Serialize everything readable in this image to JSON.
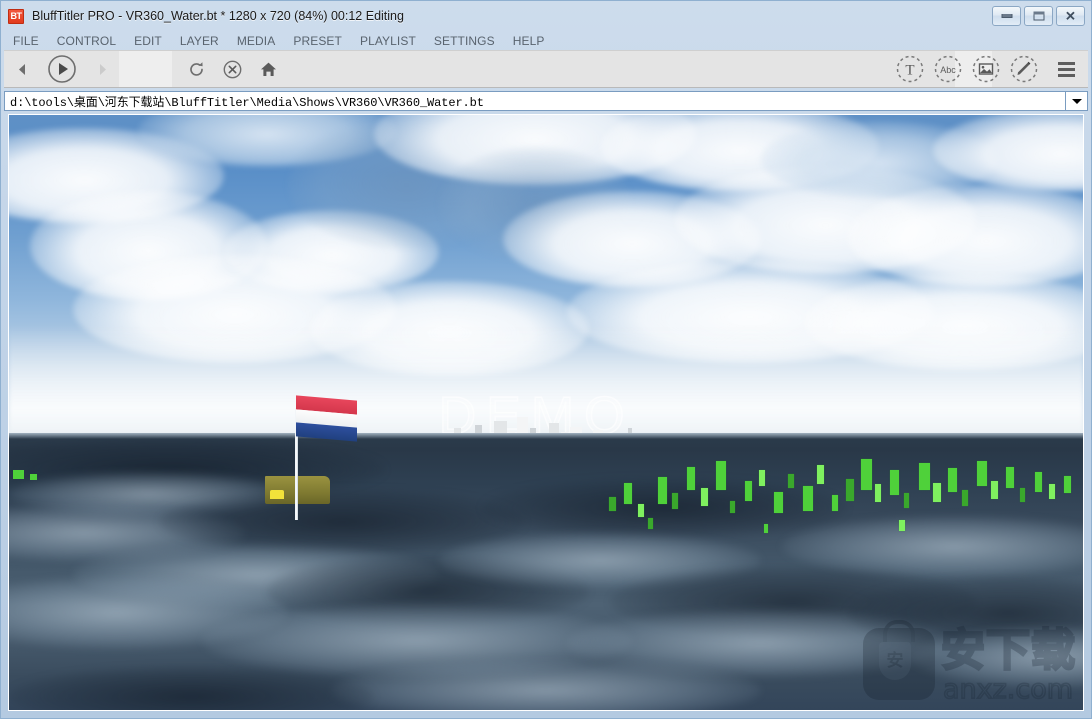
{
  "window": {
    "app_name": "BluffTitler PRO",
    "title": "BluffTitler PRO  - VR360_Water.bt * 1280 x 720 (84%) 00:12 Editing",
    "app_icon": "bt-app-icon",
    "controls": {
      "minimize": "minimize-icon",
      "maximize": "maximize-icon",
      "close": "close-icon",
      "close_glyph": "✕"
    }
  },
  "menubar": {
    "items": [
      {
        "label": "FILE",
        "name": "menu-file"
      },
      {
        "label": "CONTROL",
        "name": "menu-control"
      },
      {
        "label": "EDIT",
        "name": "menu-edit"
      },
      {
        "label": "LAYER",
        "name": "menu-layer"
      },
      {
        "label": "MEDIA",
        "name": "menu-media"
      },
      {
        "label": "PRESET",
        "name": "menu-preset"
      },
      {
        "label": "PLAYLIST",
        "name": "menu-playlist"
      },
      {
        "label": "SETTINGS",
        "name": "menu-settings"
      },
      {
        "label": "HELP",
        "name": "menu-help"
      }
    ]
  },
  "toolbar": {
    "left": [
      {
        "name": "previous-button",
        "icon": "arrow-left-icon",
        "enabled": true
      },
      {
        "name": "play-button",
        "icon": "play-circle-icon",
        "enabled": true
      },
      {
        "name": "next-button",
        "icon": "arrow-right-icon",
        "enabled": false
      }
    ],
    "middle": [
      {
        "name": "refresh-button",
        "icon": "refresh-icon",
        "enabled": true
      },
      {
        "name": "stop-button",
        "icon": "stop-circle-icon",
        "enabled": true
      },
      {
        "name": "home-button",
        "icon": "home-icon",
        "enabled": true
      }
    ],
    "right": [
      {
        "name": "add-text-layer-button",
        "icon": "text-layer-icon",
        "glyph": "T"
      },
      {
        "name": "add-font-layer-button",
        "icon": "font-abc-icon",
        "glyph": "Abc"
      },
      {
        "name": "add-picture-layer-button",
        "icon": "picture-icon"
      },
      {
        "name": "add-effect-layer-button",
        "icon": "pencil-icon"
      },
      {
        "name": "main-menu-button",
        "icon": "hamburger-menu-icon"
      }
    ]
  },
  "pathbar": {
    "value": "d:\\tools\\桌面\\河东下载站\\BluffTitler\\Media\\Shows\\VR360\\VR360_Water.bt",
    "placeholder": "",
    "dropdown": "path-dropdown-icon"
  },
  "viewport": {
    "name": "render-preview",
    "scene_title": "VR360_Water",
    "watermark_demo": "DEMO",
    "site_watermark": {
      "icon": "anxz-bag-icon",
      "shield_char": "安",
      "text_cn": "安下载",
      "url": "anxz.com"
    },
    "elements": {
      "sky": "sky-background",
      "water": "water-surface",
      "skyline": "city-skyline",
      "flag": "dutch-flag",
      "boat": "yellow-boat",
      "vegetation": "green-reeds"
    }
  },
  "colors": {
    "sky_blue": "#5e90c6",
    "water_dark": "#2c3c4c",
    "water_light": "#4e6274",
    "flag_red": "#e8465c",
    "flag_white": "#fdfdfd",
    "flag_blue": "#2e4f9e",
    "boat_yellow": "#f2e23a",
    "vegetation_green": "#4fd13a",
    "chrome": "#c2d4e8",
    "toolbar_bg": "#e4e4e4",
    "accent_icon": "#e23b1d"
  }
}
